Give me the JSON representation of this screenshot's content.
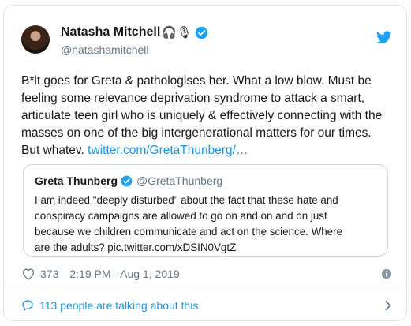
{
  "author": {
    "display_name": "Natasha Mitchell",
    "emoji": "🎧🎙",
    "handle": "@natashamitchell"
  },
  "icons": {
    "verified": "verified-badge-icon",
    "brand": "twitter-bird-icon",
    "like": "heart-icon",
    "info": "info-icon",
    "conversation": "speech-bubble-icon",
    "expand": "chevron-right-icon"
  },
  "colors": {
    "link": "#1b95e0",
    "verified": "#1da1f2",
    "secondary_text": "#657786",
    "border": "#e1e8ed"
  },
  "tweet": {
    "text_line1": "B*lt goes for Greta & pathologises her. What a low blow. Must be",
    "text_line2": "feeling some relevance deprivation syndrome to attack a smart,",
    "text_line3": "articulate teen girl who is uniquely & effectively connecting with the",
    "text_line4": "masses on one of the big intergenerational matters for our times.",
    "text_line5_prefix": "But whatev. ",
    "link": "twitter.com/GretaThunberg/…"
  },
  "quoted_tweet": {
    "display_name": "Greta Thunberg",
    "handle": "@GretaThunberg",
    "text_line1": "I am indeed \"deeply disturbed\" about the fact that these hate and",
    "text_line2": "conspiracy campaigns are allowed to go on and on and on just",
    "text_line3": "because we children communicate and act on the science. Where",
    "text_line4": "are the adults? pic.twitter.com/xDSIN0VgtZ"
  },
  "meta": {
    "likes": "373",
    "timestamp": "2:19 PM - Aug 1, 2019"
  },
  "footer": {
    "conversation_label": "113 people are talking about this"
  }
}
